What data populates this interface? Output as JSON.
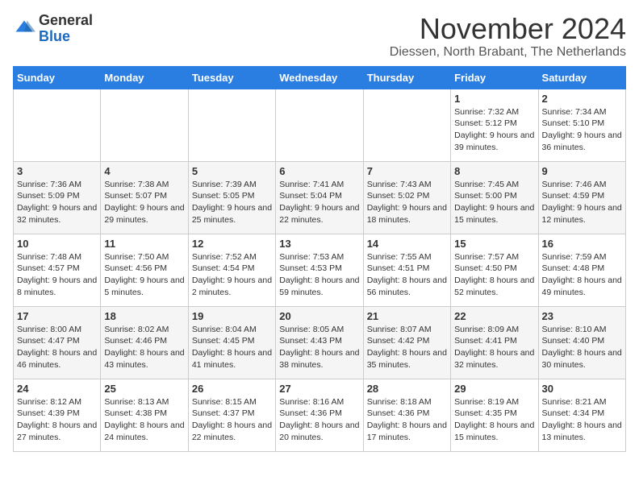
{
  "logo": {
    "general": "General",
    "blue": "Blue"
  },
  "header": {
    "month_title": "November 2024",
    "subtitle": "Diessen, North Brabant, The Netherlands"
  },
  "weekdays": [
    "Sunday",
    "Monday",
    "Tuesday",
    "Wednesday",
    "Thursday",
    "Friday",
    "Saturday"
  ],
  "weeks": [
    [
      {
        "day": "",
        "sunrise": "",
        "sunset": "",
        "daylight": ""
      },
      {
        "day": "",
        "sunrise": "",
        "sunset": "",
        "daylight": ""
      },
      {
        "day": "",
        "sunrise": "",
        "sunset": "",
        "daylight": ""
      },
      {
        "day": "",
        "sunrise": "",
        "sunset": "",
        "daylight": ""
      },
      {
        "day": "",
        "sunrise": "",
        "sunset": "",
        "daylight": ""
      },
      {
        "day": "1",
        "sunrise": "Sunrise: 7:32 AM",
        "sunset": "Sunset: 5:12 PM",
        "daylight": "Daylight: 9 hours and 39 minutes."
      },
      {
        "day": "2",
        "sunrise": "Sunrise: 7:34 AM",
        "sunset": "Sunset: 5:10 PM",
        "daylight": "Daylight: 9 hours and 36 minutes."
      }
    ],
    [
      {
        "day": "3",
        "sunrise": "Sunrise: 7:36 AM",
        "sunset": "Sunset: 5:09 PM",
        "daylight": "Daylight: 9 hours and 32 minutes."
      },
      {
        "day": "4",
        "sunrise": "Sunrise: 7:38 AM",
        "sunset": "Sunset: 5:07 PM",
        "daylight": "Daylight: 9 hours and 29 minutes."
      },
      {
        "day": "5",
        "sunrise": "Sunrise: 7:39 AM",
        "sunset": "Sunset: 5:05 PM",
        "daylight": "Daylight: 9 hours and 25 minutes."
      },
      {
        "day": "6",
        "sunrise": "Sunrise: 7:41 AM",
        "sunset": "Sunset: 5:04 PM",
        "daylight": "Daylight: 9 hours and 22 minutes."
      },
      {
        "day": "7",
        "sunrise": "Sunrise: 7:43 AM",
        "sunset": "Sunset: 5:02 PM",
        "daylight": "Daylight: 9 hours and 18 minutes."
      },
      {
        "day": "8",
        "sunrise": "Sunrise: 7:45 AM",
        "sunset": "Sunset: 5:00 PM",
        "daylight": "Daylight: 9 hours and 15 minutes."
      },
      {
        "day": "9",
        "sunrise": "Sunrise: 7:46 AM",
        "sunset": "Sunset: 4:59 PM",
        "daylight": "Daylight: 9 hours and 12 minutes."
      }
    ],
    [
      {
        "day": "10",
        "sunrise": "Sunrise: 7:48 AM",
        "sunset": "Sunset: 4:57 PM",
        "daylight": "Daylight: 9 hours and 8 minutes."
      },
      {
        "day": "11",
        "sunrise": "Sunrise: 7:50 AM",
        "sunset": "Sunset: 4:56 PM",
        "daylight": "Daylight: 9 hours and 5 minutes."
      },
      {
        "day": "12",
        "sunrise": "Sunrise: 7:52 AM",
        "sunset": "Sunset: 4:54 PM",
        "daylight": "Daylight: 9 hours and 2 minutes."
      },
      {
        "day": "13",
        "sunrise": "Sunrise: 7:53 AM",
        "sunset": "Sunset: 4:53 PM",
        "daylight": "Daylight: 8 hours and 59 minutes."
      },
      {
        "day": "14",
        "sunrise": "Sunrise: 7:55 AM",
        "sunset": "Sunset: 4:51 PM",
        "daylight": "Daylight: 8 hours and 56 minutes."
      },
      {
        "day": "15",
        "sunrise": "Sunrise: 7:57 AM",
        "sunset": "Sunset: 4:50 PM",
        "daylight": "Daylight: 8 hours and 52 minutes."
      },
      {
        "day": "16",
        "sunrise": "Sunrise: 7:59 AM",
        "sunset": "Sunset: 4:48 PM",
        "daylight": "Daylight: 8 hours and 49 minutes."
      }
    ],
    [
      {
        "day": "17",
        "sunrise": "Sunrise: 8:00 AM",
        "sunset": "Sunset: 4:47 PM",
        "daylight": "Daylight: 8 hours and 46 minutes."
      },
      {
        "day": "18",
        "sunrise": "Sunrise: 8:02 AM",
        "sunset": "Sunset: 4:46 PM",
        "daylight": "Daylight: 8 hours and 43 minutes."
      },
      {
        "day": "19",
        "sunrise": "Sunrise: 8:04 AM",
        "sunset": "Sunset: 4:45 PM",
        "daylight": "Daylight: 8 hours and 41 minutes."
      },
      {
        "day": "20",
        "sunrise": "Sunrise: 8:05 AM",
        "sunset": "Sunset: 4:43 PM",
        "daylight": "Daylight: 8 hours and 38 minutes."
      },
      {
        "day": "21",
        "sunrise": "Sunrise: 8:07 AM",
        "sunset": "Sunset: 4:42 PM",
        "daylight": "Daylight: 8 hours and 35 minutes."
      },
      {
        "day": "22",
        "sunrise": "Sunrise: 8:09 AM",
        "sunset": "Sunset: 4:41 PM",
        "daylight": "Daylight: 8 hours and 32 minutes."
      },
      {
        "day": "23",
        "sunrise": "Sunrise: 8:10 AM",
        "sunset": "Sunset: 4:40 PM",
        "daylight": "Daylight: 8 hours and 30 minutes."
      }
    ],
    [
      {
        "day": "24",
        "sunrise": "Sunrise: 8:12 AM",
        "sunset": "Sunset: 4:39 PM",
        "daylight": "Daylight: 8 hours and 27 minutes."
      },
      {
        "day": "25",
        "sunrise": "Sunrise: 8:13 AM",
        "sunset": "Sunset: 4:38 PM",
        "daylight": "Daylight: 8 hours and 24 minutes."
      },
      {
        "day": "26",
        "sunrise": "Sunrise: 8:15 AM",
        "sunset": "Sunset: 4:37 PM",
        "daylight": "Daylight: 8 hours and 22 minutes."
      },
      {
        "day": "27",
        "sunrise": "Sunrise: 8:16 AM",
        "sunset": "Sunset: 4:36 PM",
        "daylight": "Daylight: 8 hours and 20 minutes."
      },
      {
        "day": "28",
        "sunrise": "Sunrise: 8:18 AM",
        "sunset": "Sunset: 4:36 PM",
        "daylight": "Daylight: 8 hours and 17 minutes."
      },
      {
        "day": "29",
        "sunrise": "Sunrise: 8:19 AM",
        "sunset": "Sunset: 4:35 PM",
        "daylight": "Daylight: 8 hours and 15 minutes."
      },
      {
        "day": "30",
        "sunrise": "Sunrise: 8:21 AM",
        "sunset": "Sunset: 4:34 PM",
        "daylight": "Daylight: 8 hours and 13 minutes."
      }
    ]
  ]
}
